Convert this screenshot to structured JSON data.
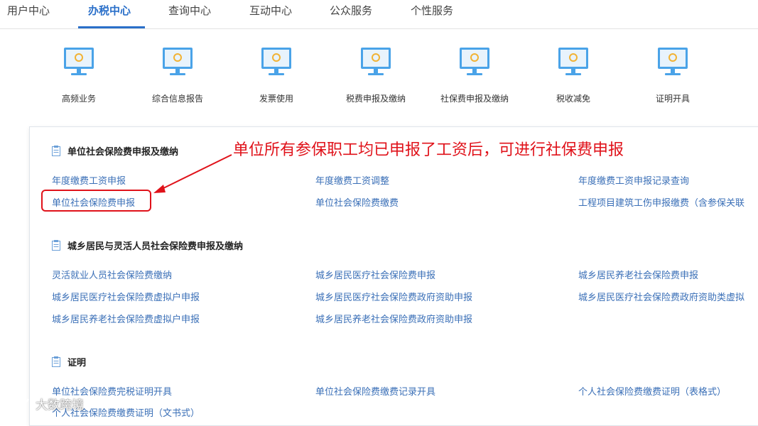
{
  "nav": {
    "tabs": [
      "用户中心",
      "办税中心",
      "查询中心",
      "互动中心",
      "公众服务",
      "个性服务"
    ],
    "active_tab": "办税中心"
  },
  "services": [
    {
      "label": "高频业务",
      "icon": "monitor-icon"
    },
    {
      "label": "综合信息报告",
      "icon": "monitor-icon"
    },
    {
      "label": "发票使用",
      "icon": "monitor-icon"
    },
    {
      "label": "税费申报及缴纳",
      "icon": "monitor-icon"
    },
    {
      "label": "社保费申报及缴纳",
      "icon": "monitor-icon"
    },
    {
      "label": "税收减免",
      "icon": "monitor-icon"
    },
    {
      "label": "证明开具",
      "icon": "monitor-icon"
    }
  ],
  "sections": [
    {
      "title": "单位社会保险费申报及缴纳",
      "links": [
        "年度缴费工资申报",
        "年度缴费工资调整",
        "年度缴费工资申报记录查询",
        "单位社会保险费申报",
        "单位社会保险费缴费",
        "工程项目建筑工伤申报缴费（含参保关联"
      ]
    },
    {
      "title": "城乡居民与灵活人员社会保险费申报及缴纳",
      "links": [
        "灵活就业人员社会保险费缴纳",
        "城乡居民医疗社会保险费申报",
        "城乡居民养老社会保险费申报",
        "城乡居民医疗社会保险费虚拟户申报",
        "城乡居民医疗社会保险费政府资助申报",
        "城乡居民医疗社会保险费政府资助类虚拟",
        "城乡居民养老社会保险费虚拟户申报",
        "城乡居民养老社会保险费政府资助申报"
      ]
    },
    {
      "title": "证明",
      "links": [
        "单位社会保险费完税证明开具",
        "单位社会保险费缴费记录开具",
        "个人社会保险费缴费证明（表格式）",
        "个人社会保险费缴费证明（文书式）"
      ]
    }
  ],
  "annotation": {
    "text": "单位所有参保职工均已申报了工资后，可进行社保费申报",
    "color": "#e0121a"
  },
  "watermark": "大数跨境",
  "colors": {
    "accent": "#2a6fc9",
    "link": "#3a6fb7",
    "annotation": "#e0121a"
  }
}
